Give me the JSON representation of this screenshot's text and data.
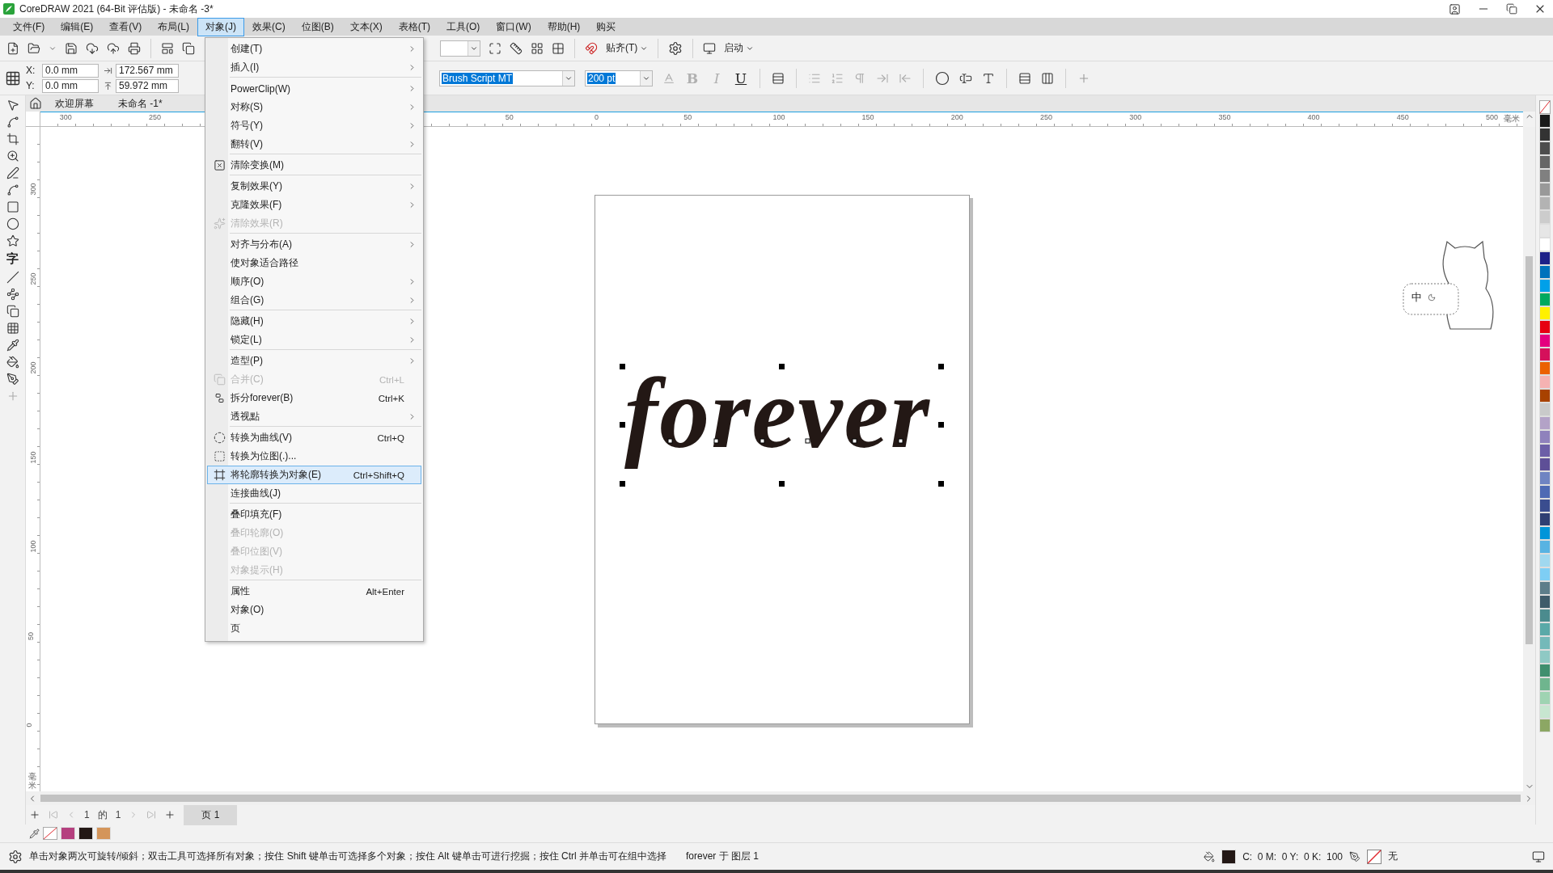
{
  "window": {
    "title": "CoreDRAW 2021 (64-Bit 评估版) - 未命名 -3*"
  },
  "menu_bar": [
    {
      "label": "文件(F)",
      "selected": false
    },
    {
      "label": "编辑(E)",
      "selected": false
    },
    {
      "label": "查看(V)",
      "selected": false
    },
    {
      "label": "布局(L)",
      "selected": false
    },
    {
      "label": "对象(J)",
      "selected": true
    },
    {
      "label": "效果(C)",
      "selected": false
    },
    {
      "label": "位图(B)",
      "selected": false
    },
    {
      "label": "文本(X)",
      "selected": false
    },
    {
      "label": "表格(T)",
      "selected": false
    },
    {
      "label": "工具(O)",
      "selected": false
    },
    {
      "label": "窗口(W)",
      "selected": false
    },
    {
      "label": "帮助(H)",
      "selected": false
    },
    {
      "label": "购买",
      "selected": false
    }
  ],
  "open_menu": {
    "groups": [
      [
        {
          "label": "创建(T)",
          "submenu": true,
          "disabled": false,
          "selected": false
        },
        {
          "label": "插入(I)",
          "submenu": true,
          "disabled": false,
          "selected": false
        }
      ],
      [
        {
          "label": "PowerClip(W)",
          "submenu": true,
          "disabled": false,
          "selected": false
        },
        {
          "label": "对称(S)",
          "submenu": true,
          "disabled": false,
          "selected": false
        },
        {
          "label": "符号(Y)",
          "submenu": true,
          "disabled": false,
          "selected": false
        },
        {
          "label": "翻转(V)",
          "submenu": true,
          "disabled": false,
          "selected": false
        }
      ],
      [
        {
          "label": "清除变换(M)",
          "submenu": false,
          "disabled": false,
          "selected": false
        }
      ],
      [
        {
          "label": "复制效果(Y)",
          "submenu": true,
          "disabled": false,
          "selected": false
        },
        {
          "label": "克隆效果(F)",
          "submenu": true,
          "disabled": false,
          "selected": false
        },
        {
          "label": "清除效果(R)",
          "submenu": false,
          "disabled": true,
          "selected": false
        }
      ],
      [
        {
          "label": "对齐与分布(A)",
          "submenu": true,
          "disabled": false,
          "selected": false
        },
        {
          "label": "使对象适合路径",
          "submenu": false,
          "disabled": false,
          "selected": false
        },
        {
          "label": "顺序(O)",
          "submenu": true,
          "disabled": false,
          "selected": false
        },
        {
          "label": "组合(G)",
          "submenu": true,
          "disabled": false,
          "selected": false
        }
      ],
      [
        {
          "label": "隐藏(H)",
          "submenu": true,
          "disabled": false,
          "selected": false
        },
        {
          "label": "锁定(L)",
          "submenu": true,
          "disabled": false,
          "selected": false
        }
      ],
      [
        {
          "label": "造型(P)",
          "submenu": true,
          "disabled": false,
          "selected": false
        },
        {
          "label": "合并(C)",
          "shortcut": "Ctrl+L",
          "submenu": false,
          "disabled": true,
          "selected": false
        },
        {
          "label": "拆分forever(B)",
          "shortcut": "Ctrl+K",
          "submenu": false,
          "disabled": false,
          "selected": false
        },
        {
          "label": "透视點",
          "submenu": true,
          "disabled": false,
          "selected": false
        }
      ],
      [
        {
          "label": "转换为曲线(V)",
          "shortcut": "Ctrl+Q",
          "submenu": false,
          "disabled": false,
          "selected": false
        },
        {
          "label": "转换为位图(.)...",
          "submenu": false,
          "disabled": false,
          "selected": false
        },
        {
          "label": "将轮廓转换为对象(E)",
          "shortcut": "Ctrl+Shift+Q",
          "submenu": false,
          "disabled": false,
          "selected": true
        },
        {
          "label": "连接曲线(J)",
          "submenu": false,
          "disabled": false,
          "selected": false
        }
      ],
      [
        {
          "label": "叠印填充(F)",
          "submenu": false,
          "disabled": false,
          "selected": false
        },
        {
          "label": "叠印轮廓(O)",
          "submenu": false,
          "disabled": true,
          "selected": false
        },
        {
          "label": "叠印位图(V)",
          "submenu": false,
          "disabled": true,
          "selected": false
        },
        {
          "label": "对象提示(H)",
          "submenu": false,
          "disabled": true,
          "selected": false
        }
      ],
      [
        {
          "label": "属性",
          "shortcut": "Alt+Enter",
          "submenu": false,
          "disabled": false,
          "selected": false
        },
        {
          "label": "对象(O)",
          "submenu": false,
          "disabled": false,
          "selected": false
        },
        {
          "label": "页",
          "submenu": false,
          "disabled": false,
          "selected": false
        }
      ]
    ]
  },
  "toolbar": {
    "snap_label": "贴齐(T)",
    "launch_label": "启动"
  },
  "property_bar": {
    "x_label": "X:",
    "x": "0.0 mm",
    "y_label": "Y:",
    "y": "0.0 mm",
    "width": "172.567 mm",
    "height": "59.972 mm",
    "font": "Brush Script MT",
    "font_size": "200 pt",
    "style_buttons": [
      {
        "label": "B",
        "disabled": true
      },
      {
        "label": "I",
        "disabled": true
      },
      {
        "label": "U",
        "disabled": false
      }
    ]
  },
  "doc_tabs": [
    {
      "label": "欢迎屏幕",
      "selected": false
    },
    {
      "label": "未命名 -1*",
      "selected": false
    }
  ],
  "toolbox": {
    "text_tool_glyph": "字"
  },
  "rulers": {
    "horizontal": [
      "300",
      "250",
      "50",
      "0",
      "50",
      "100",
      "150",
      "200",
      "250",
      "300",
      "350",
      "400",
      "450",
      "500"
    ],
    "horizontal_unit": "毫米",
    "vertical": [
      "300",
      "250",
      "200",
      "150",
      "100",
      "50",
      "0"
    ],
    "vertical_unit": "毫米"
  },
  "canvas": {
    "text": "forever"
  },
  "ime_widget": {
    "label": "中"
  },
  "palette": [
    {
      "kind": "none"
    },
    {
      "kind": "color",
      "color": "#1a1a1a"
    },
    {
      "kind": "color",
      "color": "#333333"
    },
    {
      "kind": "color",
      "color": "#4d4d4d"
    },
    {
      "kind": "color",
      "color": "#666666"
    },
    {
      "kind": "color",
      "color": "#808080"
    },
    {
      "kind": "color",
      "color": "#999999"
    },
    {
      "kind": "color",
      "color": "#b3b3b3"
    },
    {
      "kind": "color",
      "color": "#cccccc"
    },
    {
      "kind": "color",
      "color": "#e6e6e6"
    },
    {
      "kind": "color",
      "color": "#ffffff"
    },
    {
      "kind": "color",
      "color": "#1d2088"
    },
    {
      "kind": "color",
      "color": "#0072bc"
    },
    {
      "kind": "color",
      "color": "#00a0e9"
    },
    {
      "kind": "color",
      "color": "#00a95f"
    },
    {
      "kind": "color",
      "color": "#fff100"
    },
    {
      "kind": "color",
      "color": "#e60012"
    },
    {
      "kind": "color",
      "color": "#e4007f"
    },
    {
      "kind": "color",
      "color": "#d5105b"
    },
    {
      "kind": "color",
      "color": "#eb6100"
    },
    {
      "kind": "color",
      "color": "#f5b2b2"
    },
    {
      "kind": "color",
      "color": "#a84200"
    },
    {
      "kind": "color",
      "color": "#c9caca"
    },
    {
      "kind": "color",
      "color": "#b3a2c7"
    },
    {
      "kind": "color",
      "color": "#8f82bc"
    },
    {
      "kind": "color",
      "color": "#6c5fa7"
    },
    {
      "kind": "color",
      "color": "#5e4f97"
    },
    {
      "kind": "color",
      "color": "#6f84c2"
    },
    {
      "kind": "color",
      "color": "#4e6ab4"
    },
    {
      "kind": "color",
      "color": "#3a4d8f"
    },
    {
      "kind": "color",
      "color": "#2f3f73"
    },
    {
      "kind": "color",
      "color": "#0095d9"
    },
    {
      "kind": "color",
      "color": "#58b3e2"
    },
    {
      "kind": "color",
      "color": "#a0d8ef"
    },
    {
      "kind": "color",
      "color": "#7ecef4"
    },
    {
      "kind": "color",
      "color": "#5d7d8a"
    },
    {
      "kind": "color",
      "color": "#3f5b6a"
    },
    {
      "kind": "color",
      "color": "#4b8b8e"
    },
    {
      "kind": "color",
      "color": "#5aa9a8"
    },
    {
      "kind": "color",
      "color": "#74b9b9"
    },
    {
      "kind": "color",
      "color": "#8fc9c4"
    },
    {
      "kind": "color",
      "color": "#3f8f6e"
    },
    {
      "kind": "color",
      "color": "#6fb58e"
    },
    {
      "kind": "color",
      "color": "#9fd3b2"
    },
    {
      "kind": "color",
      "color": "#c7e6d0"
    },
    {
      "kind": "color",
      "color": "#8ca764"
    }
  ],
  "page_nav": {
    "current": "1",
    "of": "的",
    "total": "1",
    "page_tab": "页 1"
  },
  "document_palette": [
    {
      "kind": "none"
    },
    {
      "kind": "color",
      "color": "#b5407f"
    },
    {
      "kind": "color",
      "color": "#231815"
    },
    {
      "kind": "color",
      "color": "#d4955a"
    }
  ],
  "status_bar": {
    "hint": "单击对象两次可旋转/倾斜；双击工具可选择所有对象；按住 Shift 键单击可选择多个对象；按住 Alt 键单击可进行挖掘；按住 Ctrl 并单击可在组中选择",
    "object_info": "forever 于 图层 1",
    "fill_values": "C:  0 M:  0 Y:  0 K:  100",
    "outline": "无"
  }
}
